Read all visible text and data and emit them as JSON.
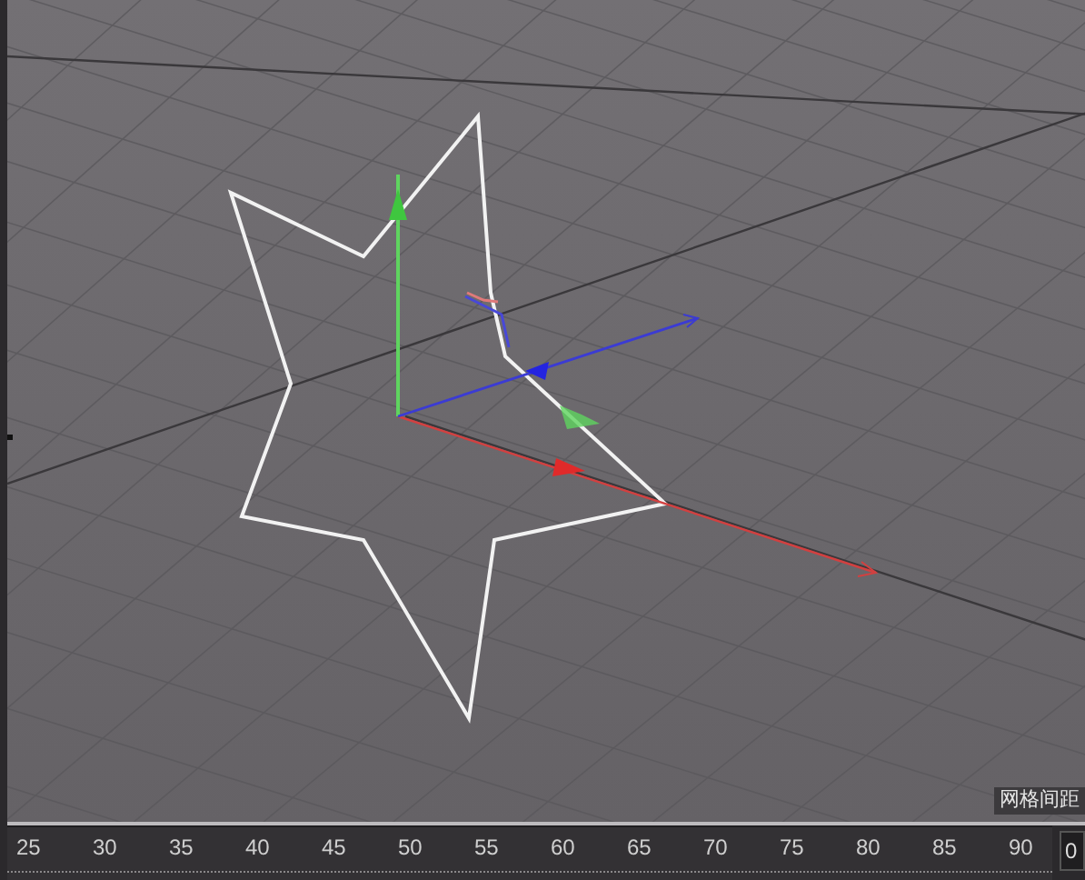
{
  "viewport": {
    "grid_label": "网格间距"
  },
  "timeline": {
    "ticks": [
      "25",
      "30",
      "35",
      "40",
      "45",
      "50",
      "55",
      "60",
      "65",
      "70",
      "75",
      "80",
      "85",
      "90"
    ]
  },
  "frame_field": {
    "value": "0"
  }
}
